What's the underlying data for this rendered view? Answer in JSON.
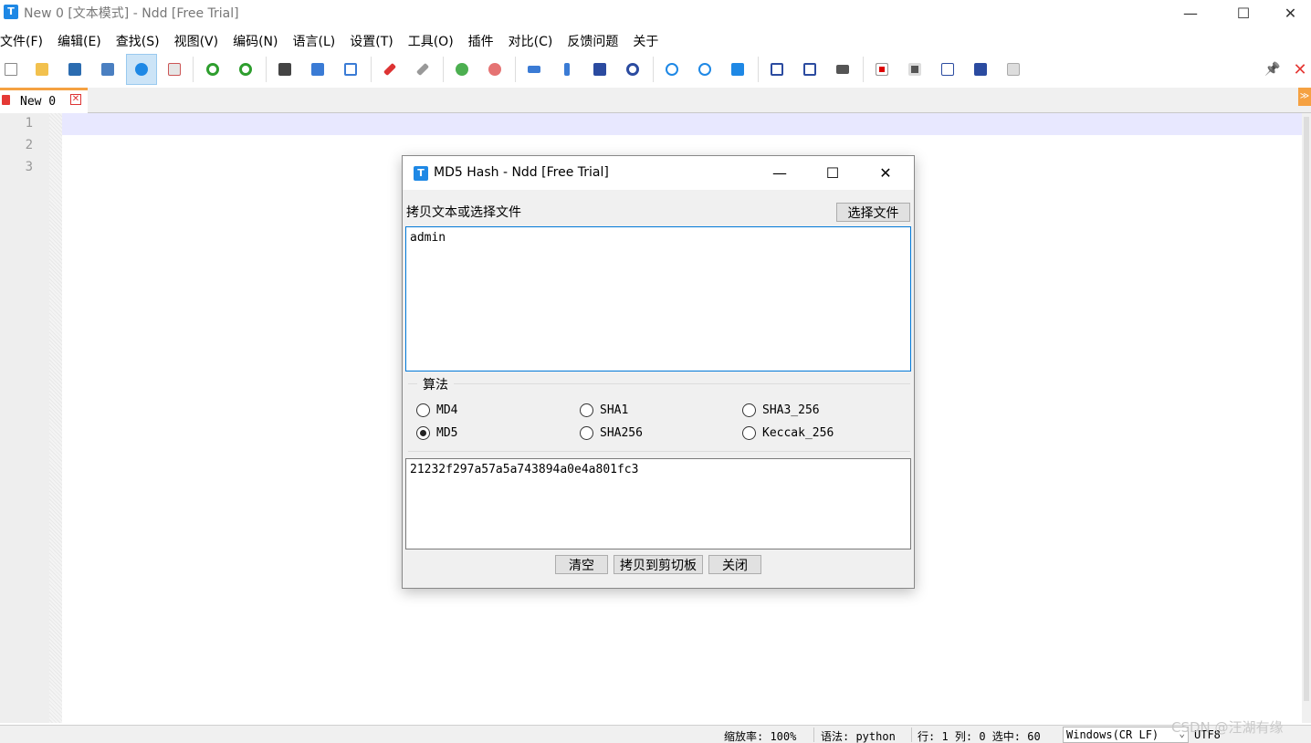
{
  "window": {
    "title": "New 0 [文本模式] - Ndd [Free Trial]",
    "app_icon_letter": "T",
    "minimize": "—",
    "maximize": "☐",
    "close": "✕"
  },
  "menubar": [
    "文件(F)",
    "编辑(E)",
    "查找(S)",
    "视图(V)",
    "编码(N)",
    "语言(L)",
    "设置(T)",
    "工具(O)",
    "插件",
    "对比(C)",
    "反馈问题",
    "关于"
  ],
  "toolbar": {
    "pin": "📌",
    "close_all": "✕"
  },
  "tabs": [
    {
      "label": "New 0",
      "close": "✕"
    }
  ],
  "tab_overflow": "≫",
  "editor": {
    "line_numbers": [
      "1",
      "2",
      "3"
    ]
  },
  "dialog": {
    "title": "MD5 Hash - Ndd [Free Trial]",
    "app_icon_letter": "T",
    "minimize": "—",
    "maximize": "☐",
    "close": "✕",
    "input_label": "拷贝文本或选择文件",
    "choose_file_button": "选择文件",
    "input_text": "admin",
    "algorithm_group_title": "算法",
    "algorithms": [
      {
        "label": "MD4",
        "checked": false
      },
      {
        "label": "SHA1",
        "checked": false
      },
      {
        "label": "SHA3_256",
        "checked": false
      },
      {
        "label": "MD5",
        "checked": true
      },
      {
        "label": "SHA256",
        "checked": false
      },
      {
        "label": "Keccak_256",
        "checked": false
      }
    ],
    "output_text": "21232f297a57a5a743894a0e4a801fc3",
    "buttons": {
      "clear": "清空",
      "copy": "拷贝到剪切板",
      "close": "关闭"
    }
  },
  "statusbar": {
    "zoom": "缩放率: 100%",
    "syntax": "语法: python",
    "position": "行: 1 列: 0 选中: 60",
    "line_ending": "Windows(CR LF)",
    "encoding": "UTF8"
  },
  "watermark": "CSDN @汪湖有缘",
  "colors": {
    "accent": "#1e88e5",
    "tab_accent": "#f5a142",
    "current_line": "#e8e8ff",
    "focus_border": "#0078d7"
  }
}
